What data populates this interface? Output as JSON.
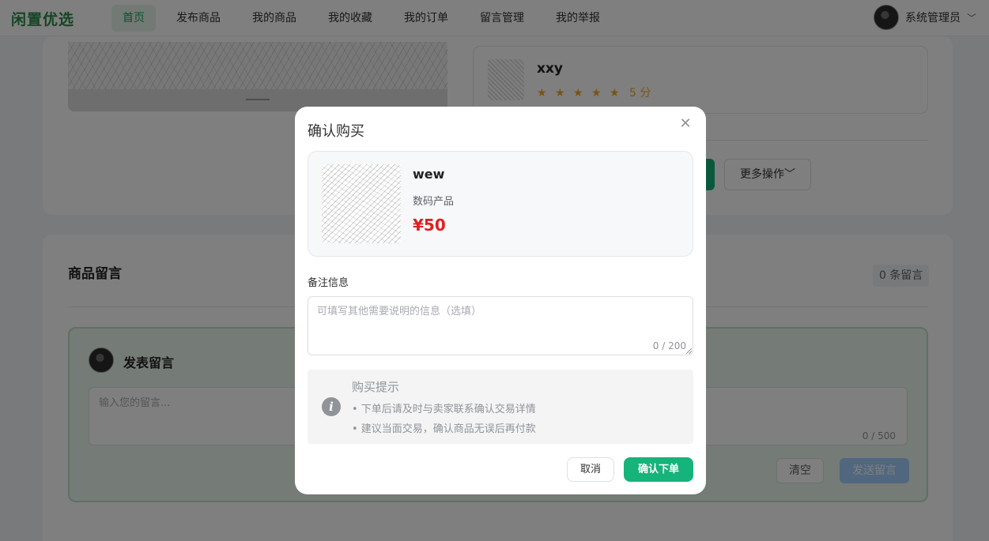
{
  "app": {
    "logo": "闲置优选"
  },
  "nav": {
    "items": [
      {
        "label": "首页",
        "active": true
      },
      {
        "label": "发布商品"
      },
      {
        "label": "我的商品"
      },
      {
        "label": "我的收藏"
      },
      {
        "label": "我的订单"
      },
      {
        "label": "留言管理"
      },
      {
        "label": "我的举报"
      }
    ]
  },
  "user": {
    "name": "系统管理员"
  },
  "seller": {
    "name": "xxy",
    "stars": "★ ★ ★ ★ ★",
    "score": "5 分"
  },
  "actions": {
    "more_label": "更多操作"
  },
  "messages": {
    "title": "商品留言",
    "count": "0 条留言",
    "post_title": "发表留言",
    "input_placeholder": "输入您的留言...",
    "counter": "0 / 500",
    "clear_label": "清空",
    "send_label": "发送留言"
  },
  "dialog": {
    "title": "确认购买",
    "close_icon": "close-icon",
    "product": {
      "name": "wew",
      "category": "数码产品",
      "price": "¥50"
    },
    "remark_label": "备注信息",
    "remark_placeholder": "可填写其他需要说明的信息（选填）",
    "remark_counter": "0 / 200",
    "tips": {
      "title": "购买提示",
      "lines": [
        "• 下单后请及时与卖家联系确认交易详情",
        "• 建议当面交易，确认商品无误后再付款"
      ]
    },
    "cancel_label": "取消",
    "confirm_label": "确认下单"
  },
  "colors": {
    "accent": "#16b37a",
    "price": "#e02020",
    "star": "#f5a623",
    "overlay": "rgba(0,0,0,0.5)"
  }
}
